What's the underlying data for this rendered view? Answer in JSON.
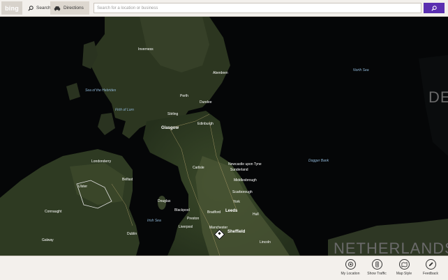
{
  "topbar": {
    "brand": "bing",
    "search_tab": "Search",
    "directions_tab": "Directions",
    "search_placeholder": "Search for a location or business",
    "go_icon": "search-icon"
  },
  "map": {
    "labels": {
      "north_sea": "North Sea",
      "sea_hebrides": "Sea of the Hebrides",
      "firth_lorn": "Firth of Lorn",
      "irish_sea": "Irish Sea",
      "dogger_bank": "Dogger Bank",
      "glasgow": "Glasgow",
      "edinburgh": "Edinburgh",
      "aberdeen": "Aberdeen",
      "dundee": "Dundee",
      "perth": "Perth",
      "inverness": "Inverness",
      "stirling": "Stirling",
      "carlisle": "Carlisle",
      "newcastle": "Newcastle upon Tyne",
      "sunderland": "Sunderland",
      "middlesbrough": "Middlesbrough",
      "scarborough": "Scarborough",
      "york": "York",
      "leeds": "Leeds",
      "bradford": "Bradford",
      "sheffield": "Sheffield",
      "manchester": "Manchester",
      "liverpool": "Liverpool",
      "preston": "Preston",
      "blackpool": "Blackpool",
      "douglas": "Douglas",
      "belfast": "Belfast",
      "londonderry": "Londonderry",
      "hull": "Hull",
      "lincoln": "Lincoln",
      "dublin": "Dublin",
      "galway": "Galway",
      "ulster": "Ulster",
      "connaught": "Connaught",
      "netherlands": "NETHERLANDS",
      "dk_partial": "DE"
    }
  },
  "bottombar": {
    "my_location": "My Location",
    "show_traffic": "Show Traffic",
    "map_style": "Map Style",
    "feedback": "Feedback"
  }
}
